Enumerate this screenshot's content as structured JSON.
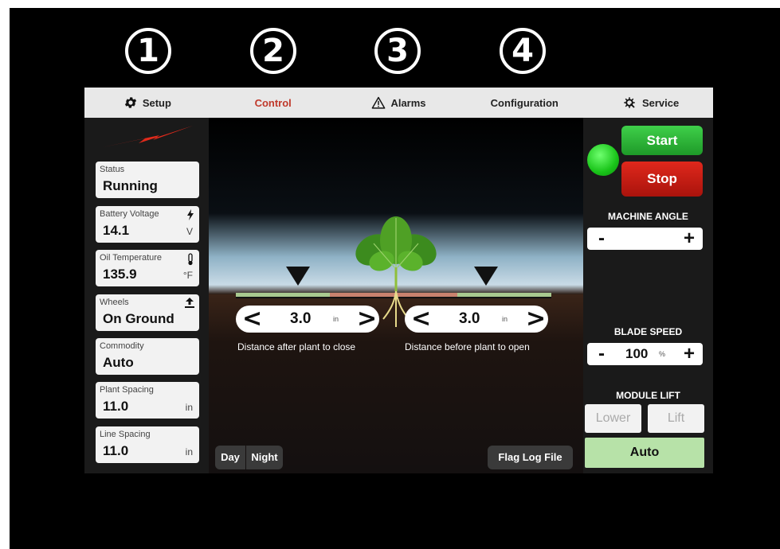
{
  "callouts": [
    "1",
    "2",
    "3",
    "4"
  ],
  "nav": {
    "setup": "Setup",
    "control": "Control",
    "alarms": "Alarms",
    "configuration": "Configuration",
    "service": "Service"
  },
  "status_cards": [
    {
      "label": "Status",
      "value": "Running",
      "unit": ""
    },
    {
      "label": "Battery Voltage",
      "value": "14.1",
      "unit": "V"
    },
    {
      "label": "Oil Temperature",
      "value": "135.9",
      "unit": "°F"
    },
    {
      "label": "Wheels",
      "value": "On Ground",
      "unit": ""
    },
    {
      "label": "Commodity",
      "value": "Auto",
      "unit": ""
    },
    {
      "label": "Plant Spacing",
      "value": "11.0",
      "unit": "in"
    },
    {
      "label": "Line Spacing",
      "value": "11.0",
      "unit": "in"
    }
  ],
  "close_stepper": {
    "left": "<",
    "value": "3.0",
    "unit": "in",
    "right": ">",
    "caption": "Distance after plant to close"
  },
  "open_stepper": {
    "left": "<",
    "value": "3.0",
    "unit": "in",
    "right": ">",
    "caption": "Distance before plant to open"
  },
  "mode": {
    "day": "Day",
    "night": "Night"
  },
  "flag_log": "Flag Log File",
  "controls": {
    "start": "Start",
    "stop": "Stop",
    "machine_angle": {
      "title": "MACHINE ANGLE",
      "minus": "-",
      "plus": "+"
    },
    "blade_speed": {
      "title": "BLADE SPEED",
      "minus": "-",
      "value": "100",
      "unit": "%",
      "plus": "+"
    },
    "module_lift": {
      "title": "MODULE LIFT",
      "lower": "Lower",
      "lift": "Lift",
      "auto": "Auto"
    }
  },
  "colors": {
    "active_nav": "#c0392b",
    "start": "#27b335",
    "stop": "#c8170e",
    "status_led": "#19c419",
    "auto": "#b7e2a8"
  }
}
